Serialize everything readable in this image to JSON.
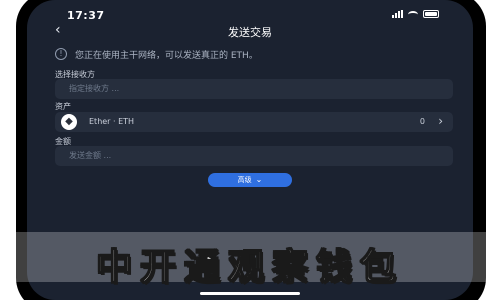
{
  "status": {
    "time": "17:37"
  },
  "header": {
    "back_icon": "chevron-left-icon",
    "title": "发送交易"
  },
  "notice": {
    "icon": "info-icon",
    "text": "您正在使用主干网络，可以发送真正的 ETH。"
  },
  "form": {
    "recipient_label": "选择接收方",
    "recipient_placeholder": "指定接收方 ...",
    "asset_label": "资产",
    "asset": {
      "icon": "ethereum-icon",
      "name": "Ether · ETH",
      "balance": "0"
    },
    "amount_label": "金额",
    "amount_placeholder": "发送金额 ..."
  },
  "advanced": {
    "label": "高级",
    "icon": "chevron-down-icon",
    "color": "#2f6fe0"
  },
  "overlay_text": "中开通观察钱包",
  "colors": {
    "screen_bg": "#1b2230",
    "field_bg": "#262e3d",
    "accent": "#2f6fe0"
  }
}
